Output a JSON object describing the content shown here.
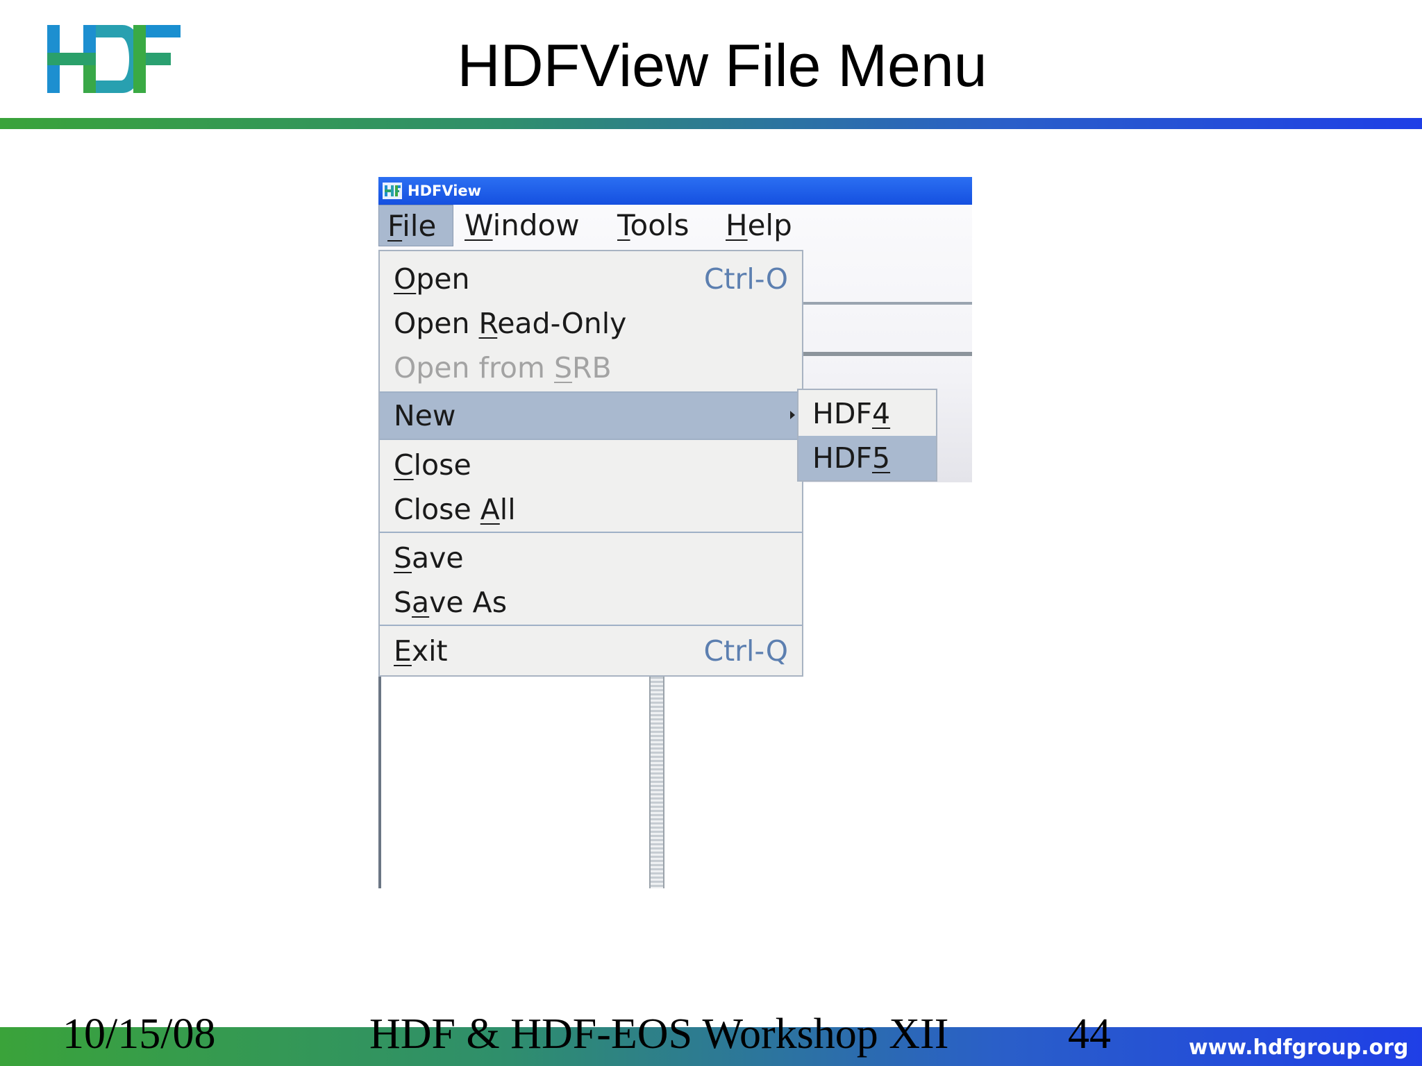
{
  "slide": {
    "title": "HDFView File Menu",
    "logo_text": "HDF",
    "footer": {
      "date": "10/15/08",
      "workshop": "HDF & HDF-EOS  Workshop XII",
      "page": "44",
      "url": "www.hdfgroup.org"
    }
  },
  "window": {
    "title": "HDFView",
    "menubar": [
      {
        "pre": "",
        "u": "F",
        "post": "ile"
      },
      {
        "pre": "",
        "u": "W",
        "post": "indow"
      },
      {
        "pre": "",
        "u": "T",
        "post": "ools"
      },
      {
        "pre": "",
        "u": "H",
        "post": "elp"
      }
    ]
  },
  "file_menu": {
    "items": [
      {
        "pre": "",
        "u": "O",
        "post": "pen",
        "accel": "Ctrl-O"
      },
      {
        "pre": "Open ",
        "u": "R",
        "post": "ead-Only",
        "accel": ""
      },
      {
        "pre": "Open from ",
        "u": "S",
        "post": "RB",
        "accel": ""
      },
      {
        "pre": "New",
        "u": "",
        "post": "",
        "accel": ""
      },
      {
        "pre": "",
        "u": "C",
        "post": "lose",
        "accel": ""
      },
      {
        "pre": "Close ",
        "u": "A",
        "post": "ll",
        "accel": ""
      },
      {
        "pre": "",
        "u": "S",
        "post": "ave",
        "accel": ""
      },
      {
        "pre": "S",
        "u": "a",
        "post": "ve As",
        "accel": ""
      },
      {
        "pre": "",
        "u": "E",
        "post": "xit",
        "accel": "Ctrl-Q"
      }
    ]
  },
  "new_submenu": {
    "items": [
      {
        "pre": "HDF",
        "u": "4",
        "post": ""
      },
      {
        "pre": "HDF",
        "u": "5",
        "post": ""
      }
    ]
  },
  "colors": {
    "accent_green": "#3aa33a",
    "accent_blue": "#1f3fe6",
    "menu_highlight": "#a9b9cf",
    "accelerator": "#5c7fb0",
    "disabled": "#a3a3a3"
  }
}
